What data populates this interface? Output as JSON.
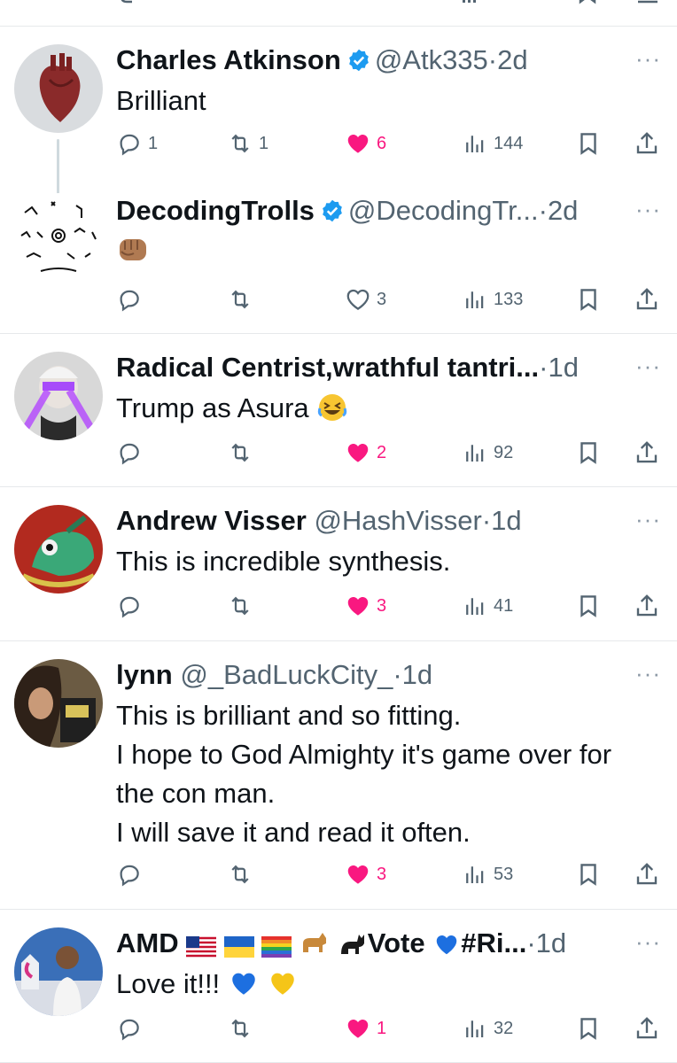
{
  "replies": [
    {
      "name": "Charles Atkinson",
      "handle": "@Atk335",
      "sep": "·",
      "time": "2d",
      "verified": true,
      "text_lines": [
        "Brilliant"
      ],
      "replies": "1",
      "reposts": "1",
      "likes": "6",
      "liked": true,
      "views": "144"
    },
    {
      "name": "DecodingTrolls",
      "handle": "@DecodingTr...",
      "sep": "·",
      "time": "2d",
      "verified": true,
      "text_lines": [
        ""
      ],
      "replies": "",
      "reposts": "",
      "likes": "3",
      "liked": false,
      "views": "133"
    },
    {
      "name": "Radical Centrist,wrathful tantri...",
      "handle": "",
      "sep": "·",
      "time": "1d",
      "verified": false,
      "text_lines": [
        "Trump as Asura"
      ],
      "replies": "",
      "reposts": "",
      "likes": "2",
      "liked": true,
      "views": "92"
    },
    {
      "name": "Andrew Visser",
      "handle": "@HashVisser",
      "sep": "·",
      "time": "1d",
      "verified": false,
      "text_lines": [
        "This is incredible synthesis."
      ],
      "replies": "",
      "reposts": "",
      "likes": "3",
      "liked": true,
      "views": "41"
    },
    {
      "name": "lynn",
      "handle": "@_BadLuckCity_",
      "sep": "·",
      "time": "1d",
      "verified": false,
      "text_lines": [
        "This is brilliant and so fitting.",
        "I hope to God Almighty it's game over for",
        "the con man.",
        "I will save it and read it often."
      ],
      "replies": "",
      "reposts": "",
      "likes": "3",
      "liked": true,
      "views": "53"
    },
    {
      "name": "AMD",
      "name_suffix": "Vote",
      "name_tail": "#Ri...",
      "handle": "",
      "sep": "·",
      "time": "1d",
      "verified": false,
      "text_lines": [
        "Love it!!!"
      ],
      "replies": "",
      "reposts": "",
      "likes": "1",
      "liked": true,
      "views": "32"
    }
  ],
  "more_label": "···",
  "icons": {
    "reply": "reply-icon",
    "repost": "repost-icon",
    "like": "heart-icon",
    "views": "views-icon",
    "bookmark": "bookmark-icon",
    "share": "share-icon",
    "verified": "verified-badge-icon"
  },
  "colors": {
    "like_active": "#f91880",
    "verified": "#1d9bf0",
    "muted": "#536471",
    "divider": "#e6e9eb"
  }
}
